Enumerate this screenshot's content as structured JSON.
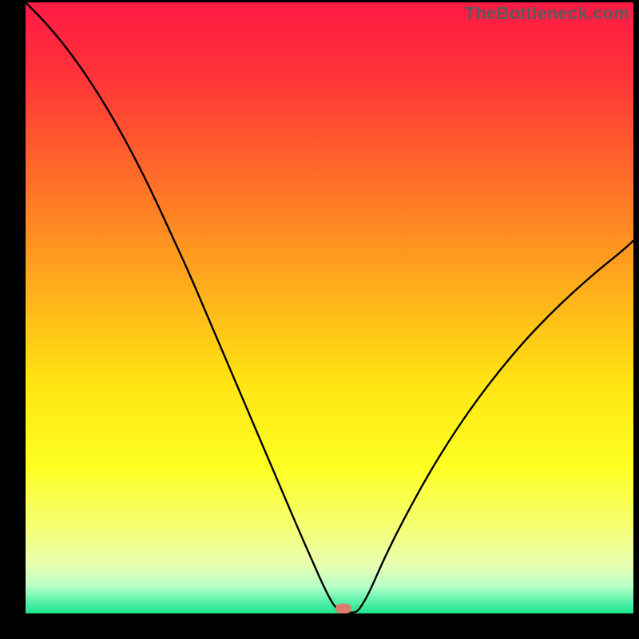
{
  "watermark": "TheBottleneck.com",
  "chart_data": {
    "type": "line",
    "title": "",
    "xlabel": "",
    "ylabel": "",
    "xlim": [
      0,
      100
    ],
    "ylim": [
      0,
      100
    ],
    "x": [
      0,
      3,
      6,
      9,
      12,
      15,
      18,
      21,
      24,
      27,
      30,
      33,
      36,
      39,
      42,
      45,
      47,
      49,
      50.5,
      51.5,
      52.3,
      53,
      54.3,
      55,
      56.5,
      59,
      62,
      66,
      70,
      74,
      78,
      82,
      86,
      90,
      94,
      98,
      100
    ],
    "values": [
      100,
      97,
      93.5,
      89.5,
      85,
      80,
      74.5,
      68.5,
      62,
      55.5,
      48.5,
      41.5,
      34.5,
      27.5,
      20.5,
      13.5,
      9,
      4.5,
      1.6,
      0.5,
      0.15,
      0.15,
      0.15,
      0.8,
      3.3,
      9,
      15,
      22.3,
      28.8,
      34.6,
      39.8,
      44.5,
      48.7,
      52.5,
      56,
      59.2,
      61
    ],
    "marker": {
      "x": 52.3,
      "width": 2.6,
      "height_pct": 1.6
    },
    "gradient_stops": [
      {
        "offset": 0.0,
        "color": "#ff1a45"
      },
      {
        "offset": 0.12,
        "color": "#ff3338"
      },
      {
        "offset": 0.3,
        "color": "#ff7128"
      },
      {
        "offset": 0.48,
        "color": "#ffb21a"
      },
      {
        "offset": 0.62,
        "color": "#ffe413"
      },
      {
        "offset": 0.76,
        "color": "#feff21"
      },
      {
        "offset": 0.86,
        "color": "#f5ff75"
      },
      {
        "offset": 0.92,
        "color": "#e8ffb0"
      },
      {
        "offset": 0.955,
        "color": "#b8ffc8"
      },
      {
        "offset": 0.975,
        "color": "#6cf5b0"
      },
      {
        "offset": 1.0,
        "color": "#1de48e"
      }
    ]
  }
}
